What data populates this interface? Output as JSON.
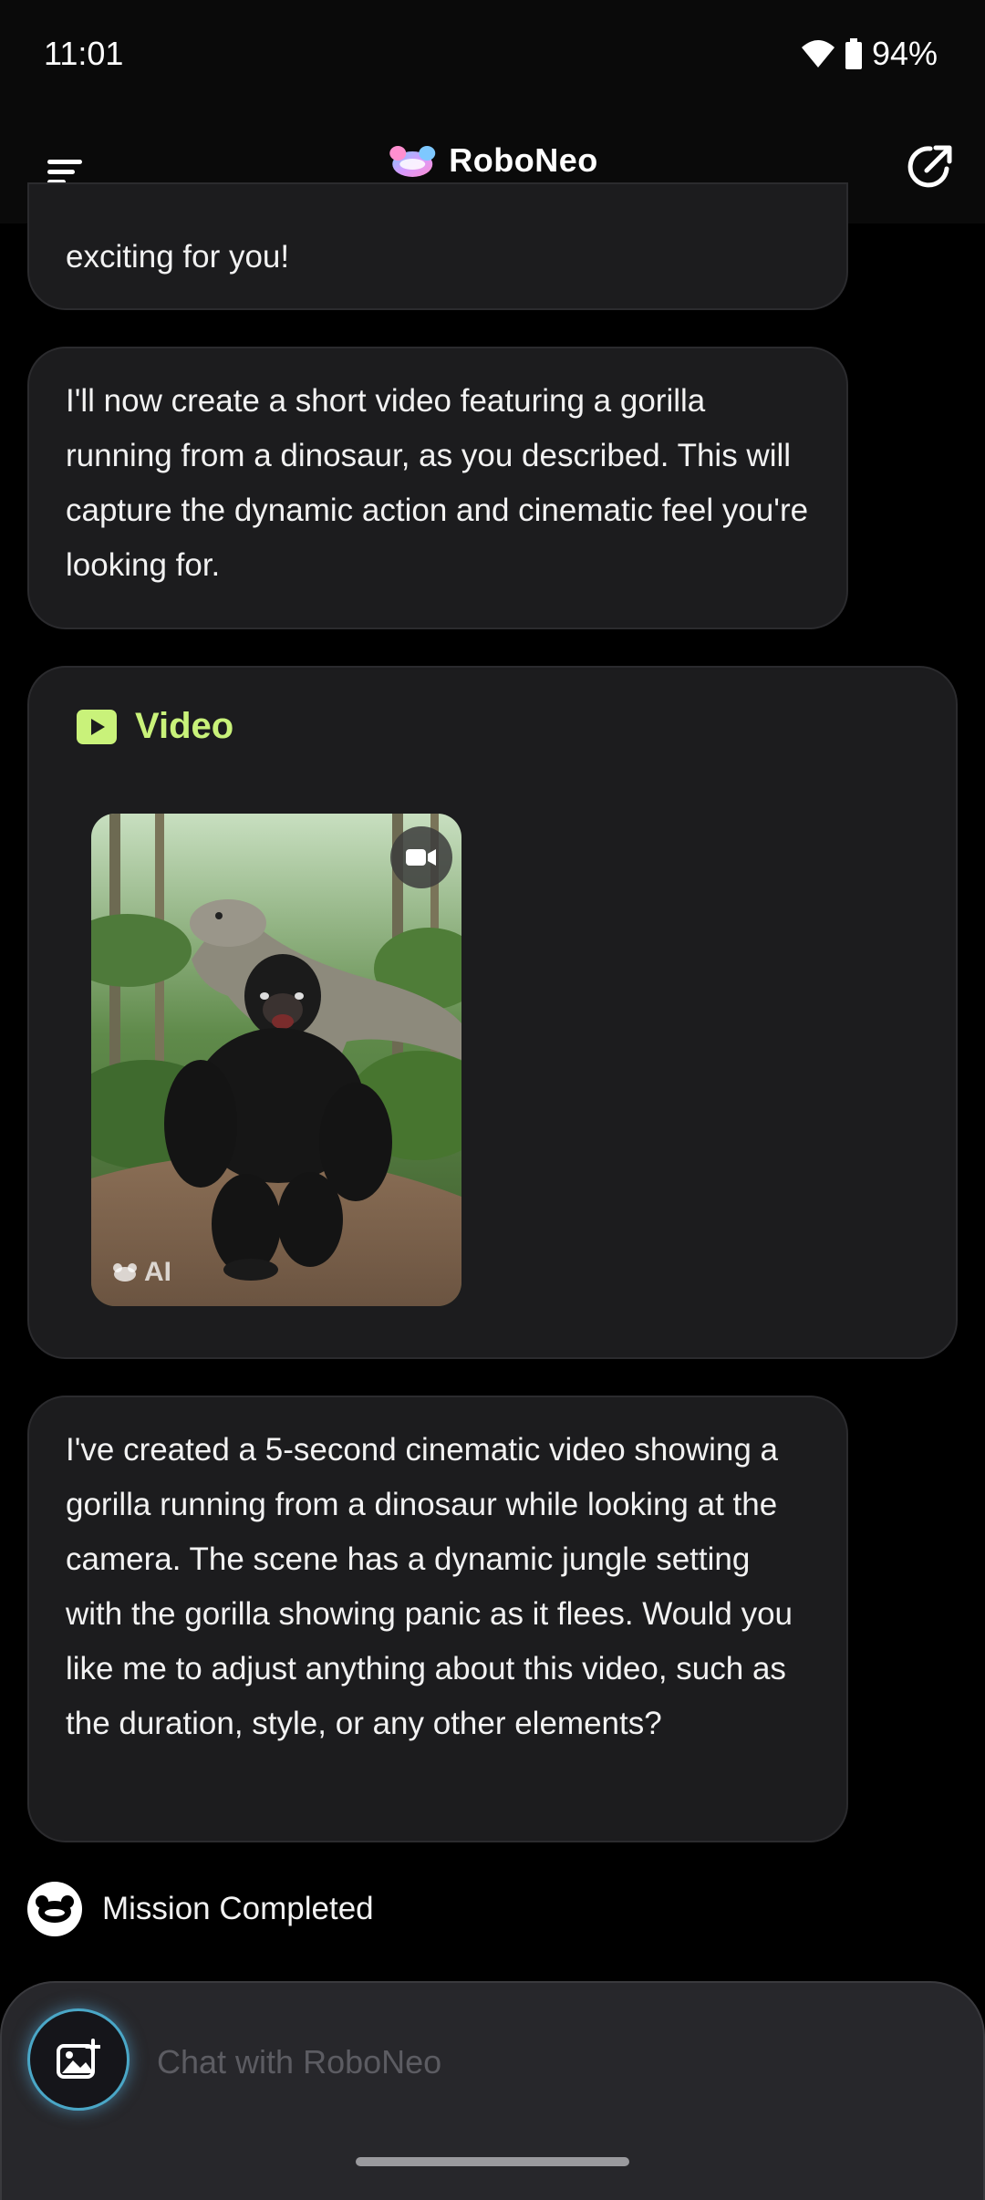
{
  "status": {
    "time": "11:01",
    "battery": "94%"
  },
  "header": {
    "app_name": "RoboNeo"
  },
  "messages": [
    {
      "text": "exciting for you!"
    },
    {
      "text": "I'll now create a short video featuring a gorilla running from a dinosaur, as you described. This will capture the dynamic action and cinematic feel you're looking for."
    },
    {
      "text": "I've created a 5-second cinematic video showing a gorilla running from a dinosaur while looking at the camera. The scene has a dynamic jungle setting with the gorilla showing panic as it flees. Would you like me to adjust anything about this video, such as the duration, style, or any other elements?"
    }
  ],
  "video_card": {
    "label": "Video",
    "watermark": "AI"
  },
  "mission": {
    "text": "Mission Completed"
  },
  "composer": {
    "placeholder": "Chat with RoboNeo"
  },
  "colors": {
    "accent": "#c9f27a",
    "background": "#000000",
    "bubble": "#1c1c1e",
    "glow": "#4aa7c7"
  },
  "icons": [
    "menu-icon",
    "roboneo-logo-icon",
    "share-icon",
    "video-play-icon",
    "camera-icon",
    "ai-logo-icon",
    "mission-robot-icon",
    "image-add-icon",
    "wifi-icon",
    "battery-icon"
  ]
}
